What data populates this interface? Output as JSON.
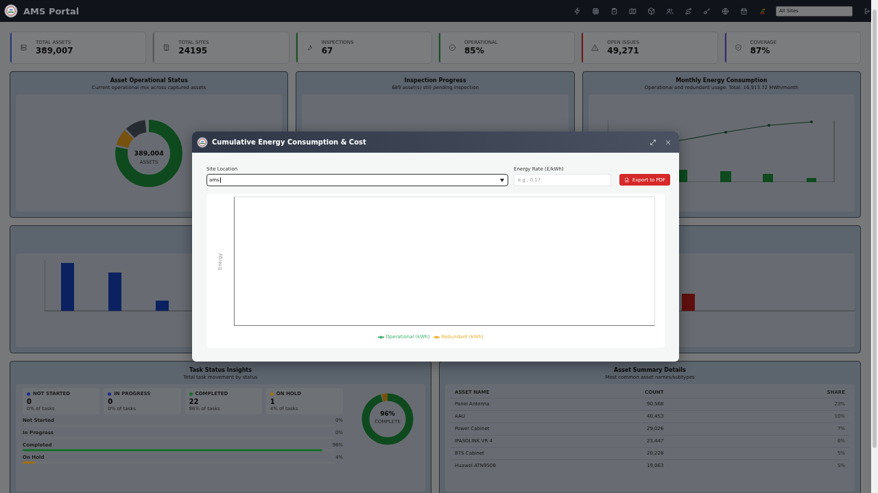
{
  "topbar": {
    "title": "AMS Portal",
    "site_filter": "All Sites"
  },
  "kpis": [
    {
      "label": "TOTAL ASSETS",
      "value": "389,007",
      "color": "#26377a"
    },
    {
      "label": "TOTAL SITES",
      "value": "24195",
      "color": "#575b5f"
    },
    {
      "label": "INSPECTIONS",
      "value": "67",
      "color": "#184f22"
    },
    {
      "label": "OPERATIONAL",
      "value": "85%",
      "color": "#184f22"
    },
    {
      "label": "OPEN ISSUES",
      "value": "49,271",
      "color": "#701818"
    },
    {
      "label": "COVERAGE",
      "value": "87%",
      "color": "#382474"
    }
  ],
  "asset_status": {
    "title": "Asset Operational Status",
    "subtitle": "Current operational mix across captured assets",
    "center_value": "389,004",
    "center_label": "ASSETS"
  },
  "inspection": {
    "title": "Inspection Progress",
    "subtitle": "689 asset(s) still pending inspection"
  },
  "energy": {
    "title": "Monthly Energy Consumption",
    "subtitle": "Operational and redundant usage. Total: 16,913.72 MWh/month"
  },
  "task_status": {
    "title": "Task Status Insights",
    "subtitle": "Total task movement by status",
    "cards": [
      {
        "label": "NOT STARTED",
        "value": "0",
        "note": "0% of tasks",
        "color": "#1e2e8e"
      },
      {
        "label": "IN PROGRESS",
        "value": "0",
        "note": "0% of tasks",
        "color": "#1e2e8e"
      },
      {
        "label": "COMPLETED",
        "value": "22",
        "note": "96% of tasks",
        "color": "#13702a"
      },
      {
        "label": "ON HOLD",
        "value": "1",
        "note": "4% of tasks",
        "color": "#a07010"
      }
    ],
    "rows": [
      {
        "label": "Not Started",
        "reading": "0%",
        "level": 0
      },
      {
        "label": "In Progress",
        "reading": "0%",
        "level": 0
      },
      {
        "label": "Completed",
        "reading": "96%",
        "level": 0.96,
        "color": "#13702a"
      },
      {
        "label": "On Hold",
        "reading": "4%",
        "level": 0.04,
        "color": "#a07010"
      }
    ],
    "donut_value": "96%",
    "donut_label": "COMPLETE"
  },
  "asset_summary": {
    "title": "Asset Summary Details",
    "subtitle": "Most common asset names/subtypes",
    "columns": [
      "ASSET NAME",
      "COUNT",
      "SHARE"
    ],
    "rows": [
      [
        "Panel Antenna",
        "90,568",
        "23%"
      ],
      [
        "AAU",
        "40,453",
        "10%"
      ],
      [
        "Power Cabinet",
        "29,026",
        "7%"
      ],
      [
        "IPASOLINK VR 4",
        "23,447",
        "6%"
      ],
      [
        "BTS Cabinet",
        "20,228",
        "5%"
      ],
      [
        "Huawei ATN950B",
        "19,063",
        "5%"
      ]
    ]
  },
  "modal": {
    "title": "Cumulative Energy Consumption & Cost",
    "site_label": "Site Location",
    "site_value": "ams",
    "rate_label": "Energy Rate (£/kWh)",
    "rate_placeholder": "e.g., 0.17",
    "export_label": "Export to PDF",
    "y_label": "Energy",
    "series": [
      {
        "name": "Operational (kWh)",
        "color": "#40b070"
      },
      {
        "name": "Redundant (kWh)",
        "color": "#e8b030"
      }
    ]
  }
}
